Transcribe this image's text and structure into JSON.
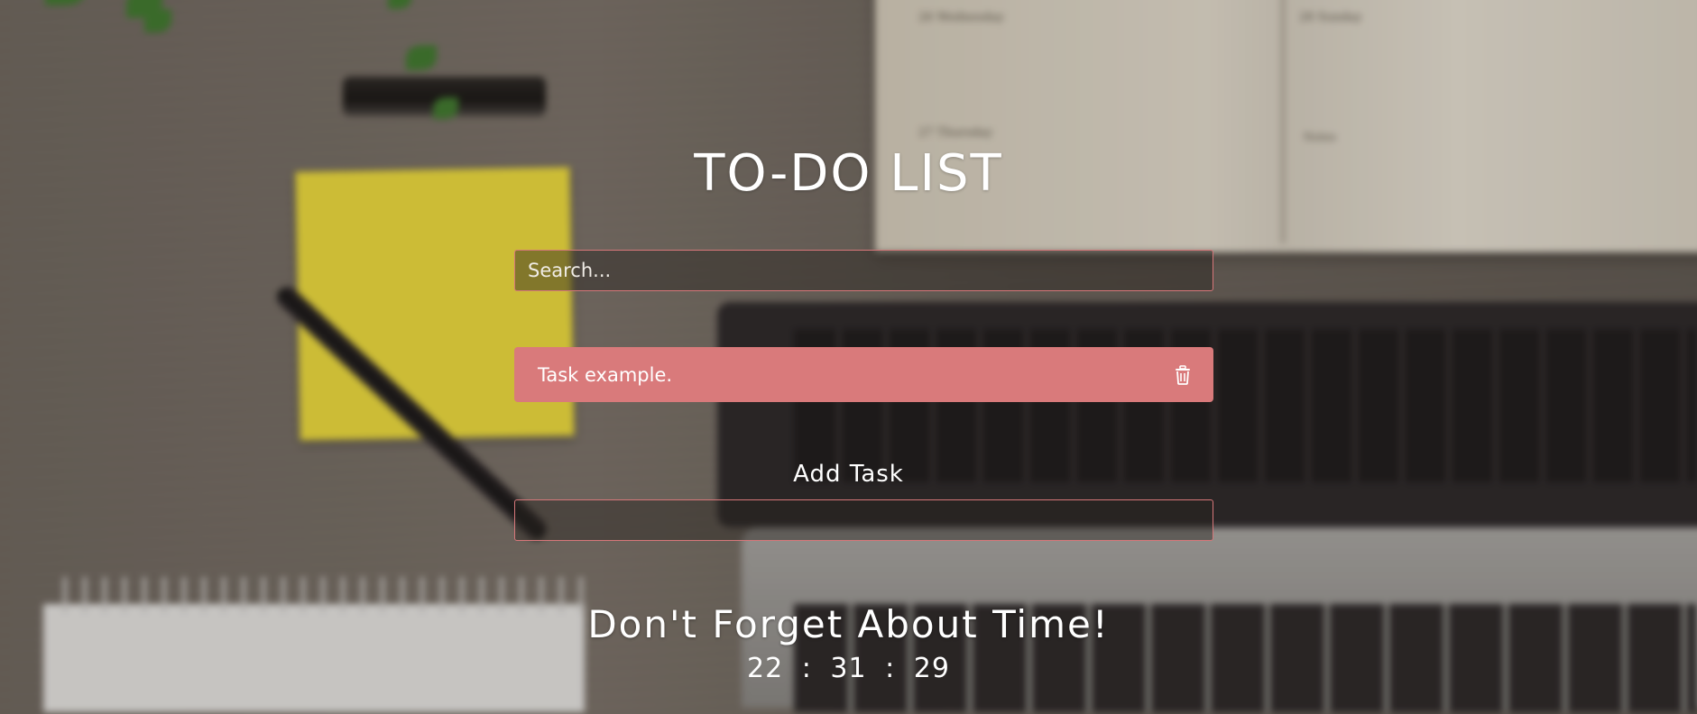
{
  "app": {
    "title": "TO-DO LIST",
    "accent_color": "#d97a7b",
    "border_color": "#d7777a"
  },
  "search": {
    "placeholder": "Search...",
    "value": ""
  },
  "tasks": [
    {
      "text": "Task example.",
      "delete_icon": "trash-icon"
    }
  ],
  "add_task": {
    "label": "Add Task",
    "value": ""
  },
  "footer": {
    "reminder": "Don't Forget About Time!",
    "clock": {
      "hours": "22",
      "minutes": "31",
      "seconds": "29",
      "separator": ":"
    }
  },
  "background": {
    "description_icon": "desk-photo",
    "notebook_text": [
      "26 Wednesday",
      "28 Sunday",
      "27 Thursday",
      "Notes"
    ]
  }
}
